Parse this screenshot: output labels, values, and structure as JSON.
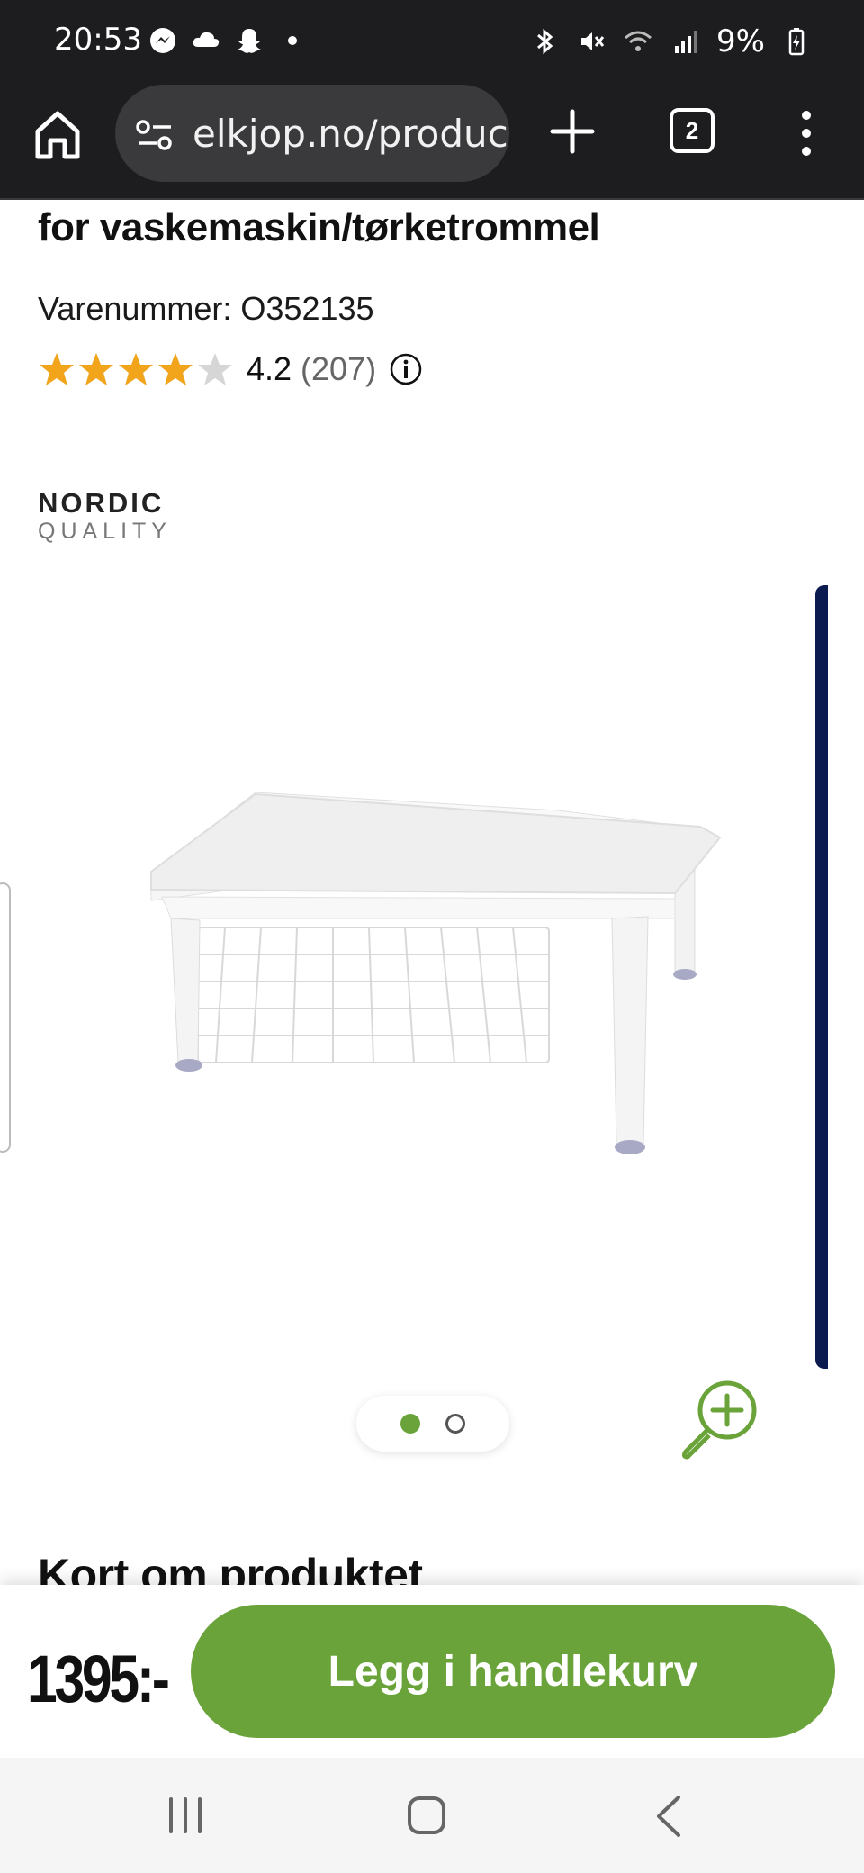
{
  "status_bar": {
    "time": "20:53",
    "battery": "9%",
    "left_icons": [
      "messenger-icon",
      "cloud-icon",
      "snapchat-icon",
      "dot-icon"
    ],
    "right_icons": [
      "bluetooth-icon",
      "mute-icon",
      "wifi-icon",
      "signal-icon",
      "battery-icon"
    ]
  },
  "browser": {
    "url": "elkjop.no/product",
    "tab_count": "2"
  },
  "product": {
    "title": "for vaskemaskin/tørketrommel",
    "sku": "Varenummer: O352135",
    "rating": 4.2,
    "rating_value": "4.2",
    "rating_count": "(207)",
    "brand_line1": "NORDIC",
    "brand_line2": "QUALITY"
  },
  "carousel": {
    "total_images": 2,
    "active_index": 0
  },
  "sections": {
    "about_heading": "Kort om produktet"
  },
  "buy_bar": {
    "price": "1395:-",
    "add_to_cart": "Legg i handlekurv"
  },
  "colors": {
    "accent_green": "#6aa33a",
    "star_gold": "#f2a51a",
    "navy": "#0b1a4f",
    "chrome_dark": "#1d1d1f"
  }
}
